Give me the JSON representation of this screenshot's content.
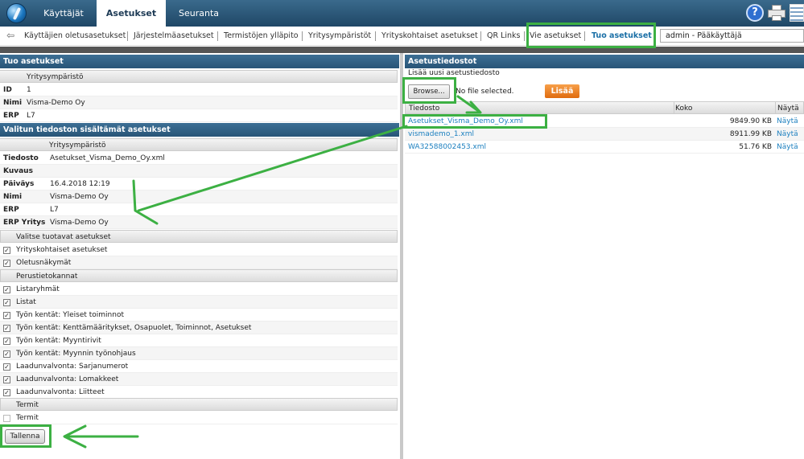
{
  "topnav": {
    "tabs": [
      {
        "label": "Käyttäjät"
      },
      {
        "label": "Asetukset"
      },
      {
        "label": "Seuranta"
      }
    ],
    "help_glyph": "?"
  },
  "subnav": {
    "items": [
      {
        "label": "Käyttäjien oletusasetukset"
      },
      {
        "label": "Järjestelmäasetukset"
      },
      {
        "label": "Termistöjen ylläpito"
      },
      {
        "label": "Yritysympäristöt"
      },
      {
        "label": "Yrityskohtaiset asetukset"
      },
      {
        "label": "QR Links"
      },
      {
        "label": "Vie asetukset"
      },
      {
        "label": "Tuo asetukset"
      }
    ],
    "user_select": "admin - Pääkäyttäjä"
  },
  "left": {
    "import_title": "Tuo asetukset",
    "env_header": "Yritysympäristö",
    "env_rows": [
      {
        "label": "ID",
        "value": "1"
      },
      {
        "label": "Nimi",
        "value": "Visma-Demo Oy"
      },
      {
        "label": "ERP",
        "value": "L7"
      }
    ],
    "contents_title": "Valitun tiedoston sisältämät asetukset",
    "contents_header": "Yritysympäristö",
    "contents_rows": [
      {
        "label": "Tiedosto",
        "value": "Asetukset_Visma_Demo_Oy.xml"
      },
      {
        "label": "Kuvaus",
        "value": ""
      },
      {
        "label": "Päiväys",
        "value": "16.4.2018 12:19"
      },
      {
        "label": "Nimi",
        "value": "Visma-Demo Oy"
      },
      {
        "label": "ERP",
        "value": "L7"
      },
      {
        "label": "ERP Yritys",
        "value": "Visma-Demo Oy"
      }
    ],
    "select_header": "Valitse tuotavat asetukset",
    "select_items": [
      {
        "label": "Yrityskohtaiset asetukset",
        "checked": "☑"
      },
      {
        "label": "Oletusnäkymät",
        "checked": "☑"
      }
    ],
    "base_header": "Perustietokannat",
    "base_items": [
      {
        "label": "Listaryhmät"
      },
      {
        "label": "Listat"
      },
      {
        "label": "Työn kentät: Yleiset toiminnot"
      },
      {
        "label": "Työn kentät: Kenttämääritykset, Osapuolet, Toiminnot, Asetukset"
      },
      {
        "label": "Työn kentät: Myyntirivit"
      },
      {
        "label": "Työn kentät: Myynnin työnohjaus"
      },
      {
        "label": "Laadunvalvonta: Sarjanumerot"
      },
      {
        "label": "Laadunvalvonta: Lomakkeet"
      },
      {
        "label": "Laadunvalvonta: Liitteet"
      }
    ],
    "terms_header": "Termit",
    "terms_item": "Termit",
    "save_label": "Tallenna"
  },
  "right": {
    "title": "Asetustiedostot",
    "add_new": "Lisää uusi asetustiedosto",
    "browse_label": "Browse...",
    "no_file": "No file selected.",
    "add_label": "Lisää",
    "columns": {
      "file": "Tiedosto",
      "size": "Koko",
      "show": "Näytä"
    },
    "files": [
      {
        "name": "Asetukset_Visma_Demo_Oy.xml",
        "size": "9849.90 KB",
        "show": "Näytä"
      },
      {
        "name": "vismademo_1.xml",
        "size": "8911.99 KB",
        "show": "Näytä"
      },
      {
        "name": "WA32588002453.xml",
        "size": "51.76 KB",
        "show": "Näytä"
      }
    ]
  },
  "colors": {
    "accent": "#3cb043",
    "header": "#285577",
    "link": "#1b7fbf",
    "add_button": "#e06b0e"
  }
}
